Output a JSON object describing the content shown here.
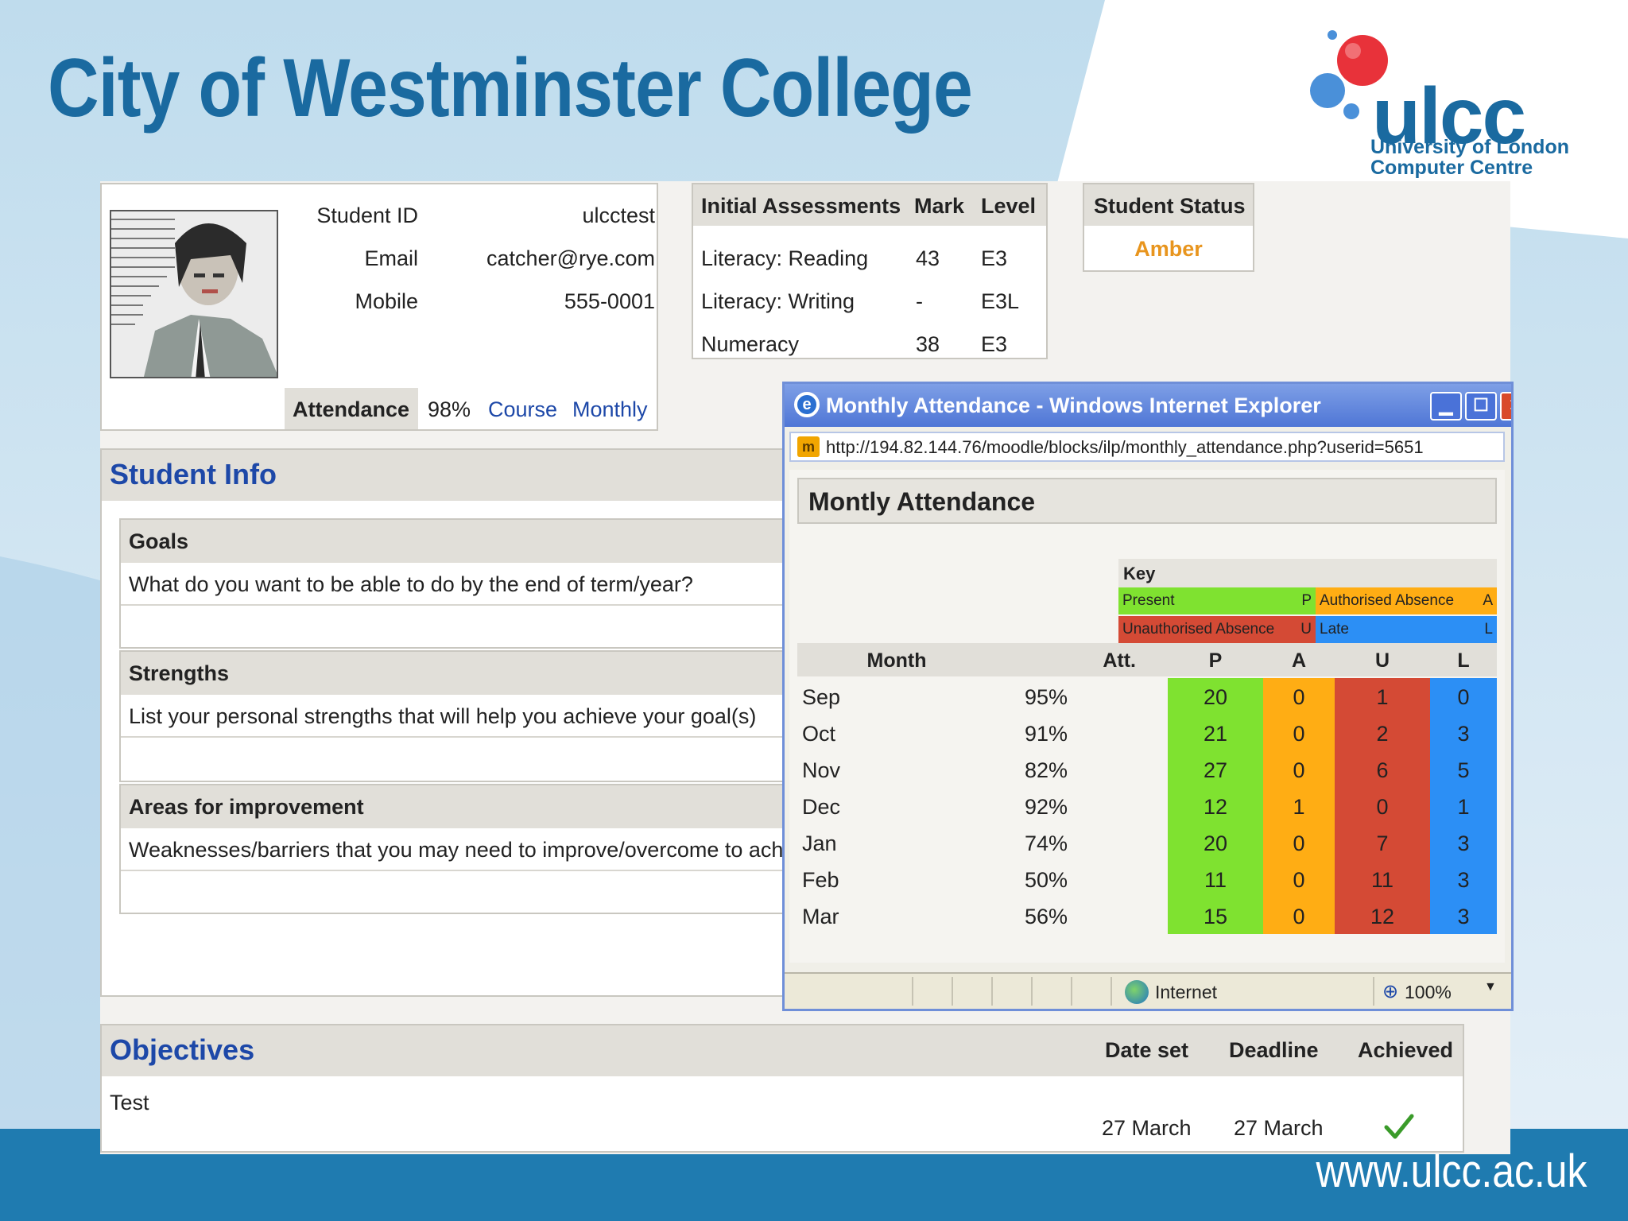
{
  "slide": {
    "title": "City of Westminster College",
    "footer_url": "www.ulcc.ac.uk",
    "logo": {
      "word": "ulcc",
      "subtitle_line1": "University of London",
      "subtitle_line2": "Computer Centre"
    },
    "colors": {
      "title": "#1a6aa0",
      "footer_band": "#1f7bb0",
      "logo_ball_red": "#e8323a",
      "logo_ball_blue": "#4a90d9"
    }
  },
  "profile": {
    "fields": [
      {
        "label": "Student ID",
        "value": "ulcctest"
      },
      {
        "label": "Email",
        "value": "catcher@rye.com"
      },
      {
        "label": "Mobile",
        "value": "555-0001"
      }
    ],
    "attendance": {
      "label": "Attendance",
      "value": "98%",
      "link_course": "Course",
      "link_monthly": "Monthly"
    }
  },
  "assessments": {
    "headers": [
      "Initial Assessments",
      "Mark",
      "Level"
    ],
    "rows": [
      [
        "Literacy: Reading",
        "43",
        "E3"
      ],
      [
        "Literacy: Writing",
        "-",
        "E3L"
      ],
      [
        "Numeracy",
        "38",
        "E3"
      ]
    ]
  },
  "student_status": {
    "header": "Student Status",
    "value": "Amber",
    "color": "#e8951e"
  },
  "student_info": {
    "title": "Student Info",
    "sections": [
      {
        "title": "Goals",
        "prompt": "What do you want to be able to do by the end of term/year?"
      },
      {
        "title": "Strengths",
        "prompt": "List your personal strengths that will help you achieve your goal(s)"
      },
      {
        "title": "Areas for improvement",
        "prompt": "Weaknesses/barriers that you may need to improve/overcome to ach"
      }
    ]
  },
  "objectives": {
    "title": "Objectives",
    "headers": [
      "Date set",
      "Deadline",
      "Achieved"
    ],
    "rows": [
      {
        "name": "Test",
        "date_set": "27 March",
        "deadline": "27 March",
        "achieved_icon": "checkmark-icon"
      }
    ]
  },
  "ie_window": {
    "title": "Monthly Attendance - Windows Internet Explorer",
    "url": "http://194.82.144.76/moodle/blocks/ilp/monthly_attendance.php?userid=5651",
    "status_zone": "Internet",
    "zoom": "100%",
    "page_title": "Montly Attendance",
    "key": {
      "label": "Key",
      "items": [
        {
          "name": "Present",
          "code": "P",
          "color": "#7fe230"
        },
        {
          "name": "Authorised Absence",
          "code": "A",
          "color": "#ffad14"
        },
        {
          "name": "Unauthorised Absence",
          "code": "U",
          "color": "#d44a35"
        },
        {
          "name": "Late",
          "code": "L",
          "color": "#2c8ff5"
        }
      ]
    },
    "table": {
      "headers": [
        "Month",
        "Att.",
        "P",
        "A",
        "U",
        "L"
      ],
      "rows": [
        {
          "month": "Sep",
          "att": "95%",
          "p": "20",
          "a": "0",
          "u": "1",
          "l": "0"
        },
        {
          "month": "Oct",
          "att": "91%",
          "p": "21",
          "a": "0",
          "u": "2",
          "l": "3"
        },
        {
          "month": "Nov",
          "att": "82%",
          "p": "27",
          "a": "0",
          "u": "6",
          "l": "5"
        },
        {
          "month": "Dec",
          "att": "92%",
          "p": "12",
          "a": "1",
          "u": "0",
          "l": "1"
        },
        {
          "month": "Jan",
          "att": "74%",
          "p": "20",
          "a": "0",
          "u": "7",
          "l": "3"
        },
        {
          "month": "Feb",
          "att": "50%",
          "p": "11",
          "a": "0",
          "u": "11",
          "l": "3"
        },
        {
          "month": "Mar",
          "att": "56%",
          "p": "15",
          "a": "0",
          "u": "12",
          "l": "3"
        }
      ]
    }
  }
}
